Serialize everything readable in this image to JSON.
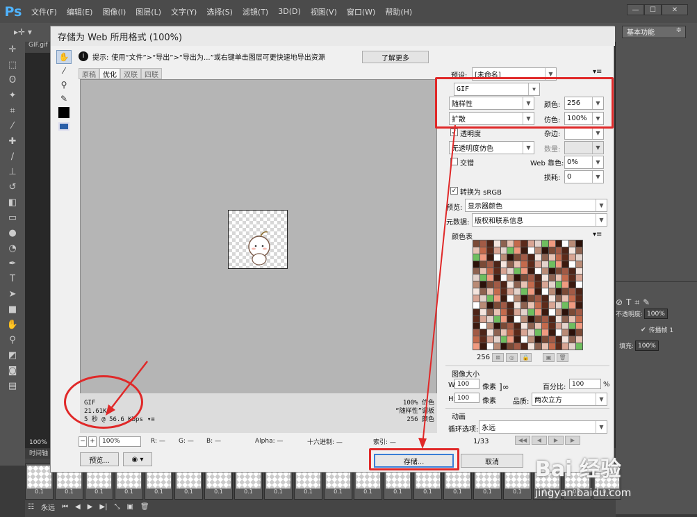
{
  "app": {
    "logo": "Ps",
    "menus": [
      "文件(F)",
      "编辑(E)",
      "图像(I)",
      "图层(L)",
      "文字(Y)",
      "选择(S)",
      "滤镜(T)",
      "3D(D)",
      "视图(V)",
      "窗口(W)",
      "帮助(H)"
    ],
    "workspace": "基本功能",
    "doc_tab": "GIF.gif",
    "zoom": "100%",
    "timeline_label": "时间轴"
  },
  "dialog": {
    "title": "存储为 Web 所用格式 (100%)",
    "tip_label": "提示:",
    "tip_text": "使用“文件”>“导出”>“导出为...”或右键单击图层可更快速地导出资源",
    "learn_more": "了解更多",
    "view_tabs": [
      "原稿",
      "优化",
      "双联",
      "四联"
    ],
    "active_tab": "优化",
    "info": {
      "format": "GIF",
      "size": "21.61K",
      "speed": "5 秒 @ 56.6 Kbps",
      "r1": "100% 仿色",
      "r2": "“随样性”调板",
      "r3": "256 颜色"
    },
    "status": {
      "zoom": "100%",
      "r": "R: —",
      "g": "G: —",
      "b": "B: —",
      "alpha": "Alpha: —",
      "hex": "十六进制: —",
      "index": "索引: —"
    },
    "preview_btn": "预览...",
    "save_btn": "存储...",
    "cancel_btn": "取消",
    "settings": {
      "preset_label": "预设:",
      "preset_value": "[未命名]",
      "format": "GIF",
      "reduction": "随样性",
      "colors_label": "颜色:",
      "colors_value": "256",
      "dither_algo": "扩散",
      "dither_label": "仿色:",
      "dither_value": "100%",
      "transparency": "透明度",
      "matte_label": "杂边:",
      "trans_dither": "无透明度仿色",
      "amount_label": "数量:",
      "interlaced": "交错",
      "web_snap_label": "Web 靠色:",
      "web_snap_value": "0%",
      "lossy_label": "损耗:",
      "lossy_value": "0",
      "convert_srgb": "转换为 sRGB",
      "preview_label": "预览:",
      "preview_value": "显示器颜色",
      "metadata_label": "元数据:",
      "metadata_value": "版权和联系信息",
      "color_table_label": "颜色表",
      "color_count": "256",
      "image_size_label": "图像大小",
      "w_label": "W:",
      "w_value": "100",
      "h_label": "H:",
      "h_value": "100",
      "px": "像素",
      "percent_label": "百分比:",
      "percent_value": "100",
      "percent_sign": "%",
      "quality_label": "品质:",
      "quality_value": "两次立方",
      "animation_label": "动画",
      "loop_label": "循环选项:",
      "loop_value": "永远",
      "frame_counter": "1/33"
    }
  },
  "layers": {
    "opacity_label": "不透明度:",
    "opacity_value": "100%",
    "propagate": "传播帧 1",
    "fill_label": "填充:",
    "fill_value": "100%"
  },
  "timeline": {
    "loop": "永远",
    "frame_delay": "0.1"
  },
  "watermark": {
    "line1": "Bai 经验",
    "line2": "jingyan.baidu.com"
  },
  "colors": {
    "annotation": "#e02828",
    "ps_blue": "#4fb3ff"
  },
  "palette": [
    "#7b4a36",
    "#5c2a1a",
    "#b98b76",
    "#e8c3b4",
    "#3b1a0f",
    "#f4e5de",
    "#6fbe5f",
    "#a25a45",
    "#d8a594",
    "#2c120a",
    "#c46a4c",
    "#ffffff",
    "#8d6250",
    "#f09a80",
    "#4d2417",
    "#e3d3cc"
  ]
}
